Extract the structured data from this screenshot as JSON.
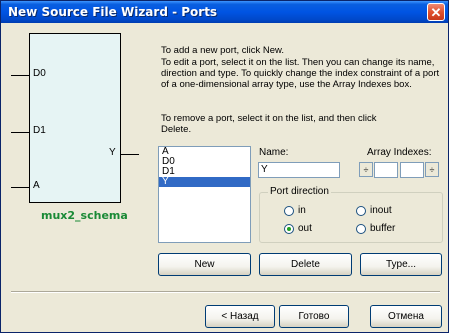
{
  "window": {
    "title": "New Source File Wizard - Ports",
    "close_glyph": "✕"
  },
  "schematic": {
    "inputs": [
      "D0",
      "D1",
      "A"
    ],
    "output": "Y",
    "name": "mux2_schema"
  },
  "instructions": {
    "add": "To add a new port, click New.",
    "edit": "To edit a port, select it on the list. Then you can change its name, direction and type. To quickly change the index constraint of a port of a one-dimensional array type, use the Array Indexes box.",
    "remove": "To remove a port, select it on the list, and then click Delete."
  },
  "port_list": {
    "items": [
      "A",
      "D0",
      "D1",
      "Y"
    ],
    "selected": "Y"
  },
  "name_field": {
    "label": "Name:",
    "value": "Y"
  },
  "array_indexes": {
    "label": "Array Indexes:",
    "from": "",
    "to": "",
    "spin_glyph": "÷"
  },
  "port_direction": {
    "title": "Port direction",
    "options": [
      "in",
      "inout",
      "out",
      "buffer"
    ],
    "selected": "out"
  },
  "buttons": {
    "new": "New",
    "delete": "Delete",
    "type": "Type...",
    "back": "< Назад",
    "finish": "Готово",
    "cancel": "Отмена"
  },
  "colors": {
    "title_bar": "#0054e3",
    "selection": "#316ac5",
    "schema_fill": "#e6f4f4",
    "schema_name": "#1a8a36",
    "close_button": "#e0502e"
  }
}
